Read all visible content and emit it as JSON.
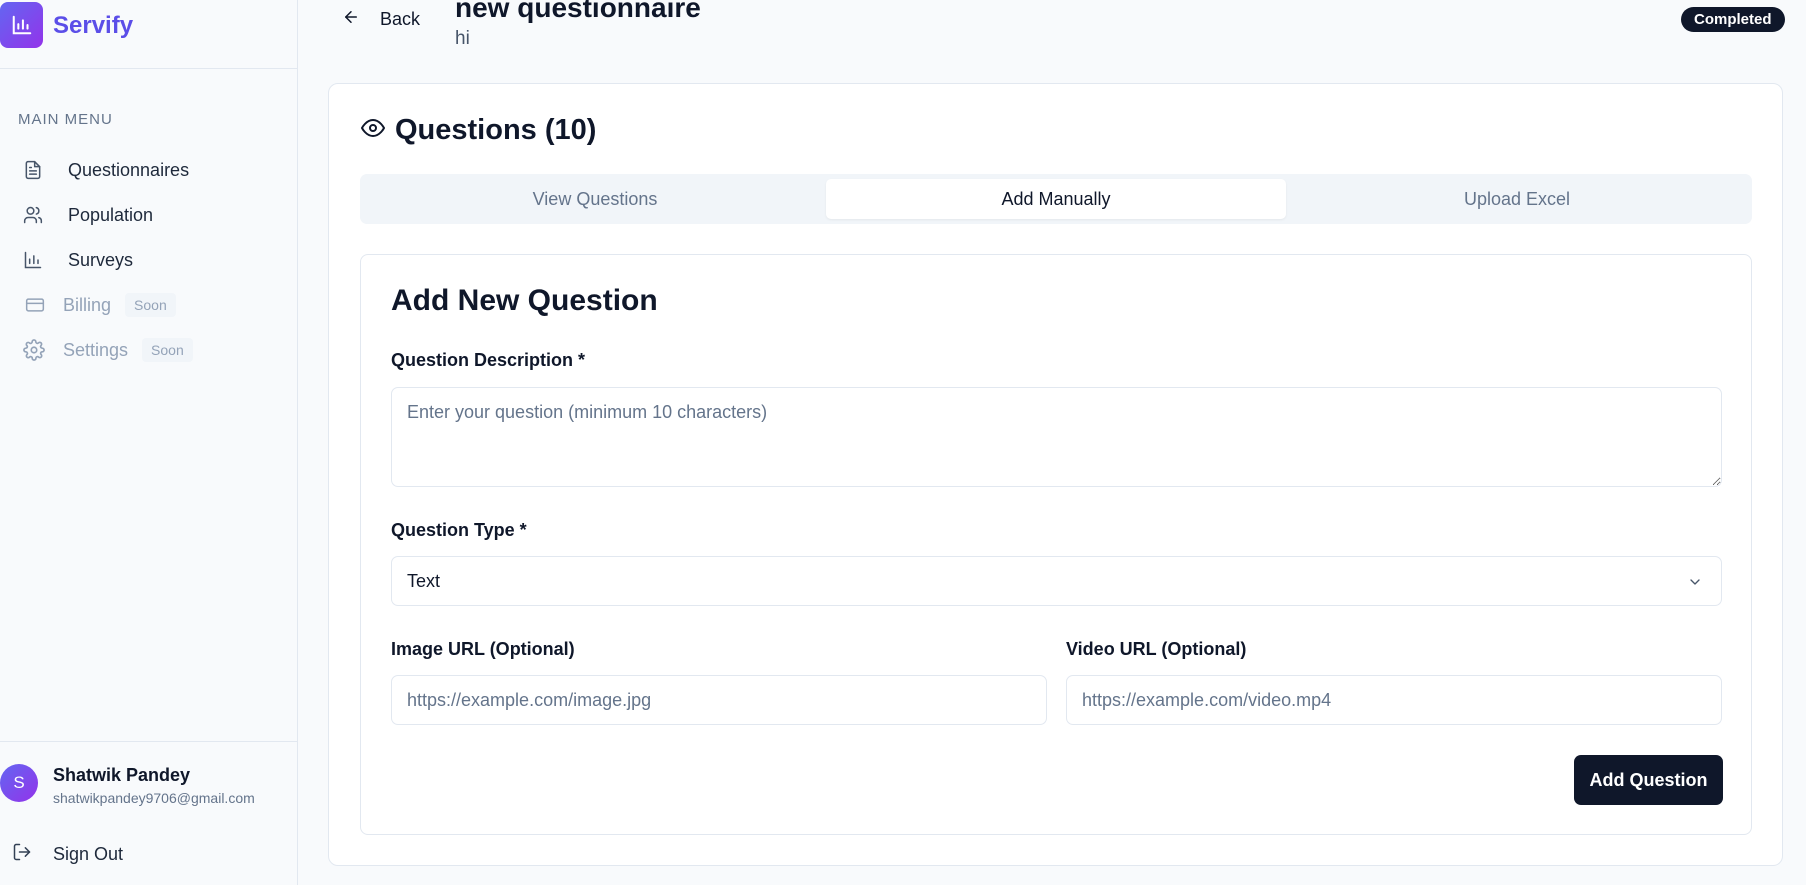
{
  "app": {
    "name": "Servify"
  },
  "sidebar": {
    "menu_title": "MAIN MENU",
    "items": [
      {
        "label": "Questionnaires",
        "icon": "file-text-icon",
        "disabled": false
      },
      {
        "label": "Population",
        "icon": "users-icon",
        "disabled": false
      },
      {
        "label": "Surveys",
        "icon": "bar-chart-icon",
        "disabled": false
      },
      {
        "label": "Billing",
        "icon": "credit-card-icon",
        "disabled": true,
        "badge": "Soon"
      },
      {
        "label": "Settings",
        "icon": "gear-icon",
        "disabled": true,
        "badge": "Soon"
      }
    ],
    "user": {
      "initial": "S",
      "name": "Shatwik Pandey",
      "email": "shatwikpandey9706@gmail.com"
    },
    "sign_out": "Sign Out"
  },
  "header": {
    "back_label": "Back",
    "title": "new questionnaire",
    "subtitle": "hi",
    "status": "Completed"
  },
  "questions_card": {
    "title": "Questions (10)",
    "tabs": [
      {
        "label": "View Questions",
        "active": false
      },
      {
        "label": "Add Manually",
        "active": true
      },
      {
        "label": "Upload Excel",
        "active": false
      }
    ]
  },
  "form": {
    "title": "Add New Question",
    "description_label": "Question Description *",
    "description_placeholder": "Enter your question (minimum 10 characters)",
    "description_value": "",
    "type_label": "Question Type *",
    "type_value": "Text",
    "image_label": "Image URL (Optional)",
    "image_placeholder": "https://example.com/image.jpg",
    "video_label": "Video URL (Optional)",
    "video_placeholder": "https://example.com/video.mp4",
    "submit_label": "Add Question"
  },
  "colors": {
    "brand": "#5b4ee8",
    "primary_dark": "#0f172a",
    "muted": "#64748b"
  }
}
